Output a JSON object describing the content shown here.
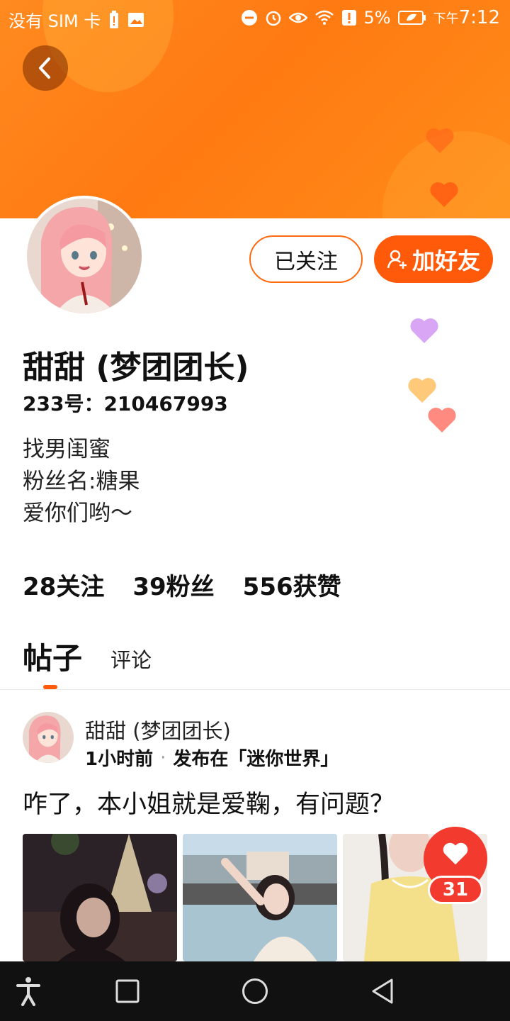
{
  "status_bar": {
    "carrier": "没有 SIM 卡",
    "battery_percent": "5%",
    "time_prefix": "下午",
    "time": "7:12"
  },
  "profile": {
    "name": "甜甜 (梦团团长)",
    "id_line": "233号：210467993",
    "bio": [
      "找男闺蜜",
      "粉丝名:糖果",
      "爱你们哟～"
    ],
    "follow_label": "已关注",
    "add_friend_label": "加好友"
  },
  "stats": {
    "following": "28关注",
    "followers": "39粉丝",
    "likes": "556获赞"
  },
  "tabs": [
    {
      "label": "帖子",
      "active": true
    },
    {
      "label": "评论",
      "active": false
    }
  ],
  "post": {
    "author": "甜甜 (梦团团长)",
    "time": "1小时前",
    "location": "发布在「迷你世界」",
    "text": "咋了，本小姐就是爱鞠，有问题？",
    "like_count": "31"
  },
  "colors": {
    "accent": "#ff5a0a",
    "banner": "#ff8a1f",
    "like_red": "#f23a2e"
  },
  "icons": [
    "back-icon",
    "person-add-icon",
    "heart-icon",
    "accessibility-icon",
    "recents-icon",
    "home-icon",
    "back-nav-icon"
  ]
}
